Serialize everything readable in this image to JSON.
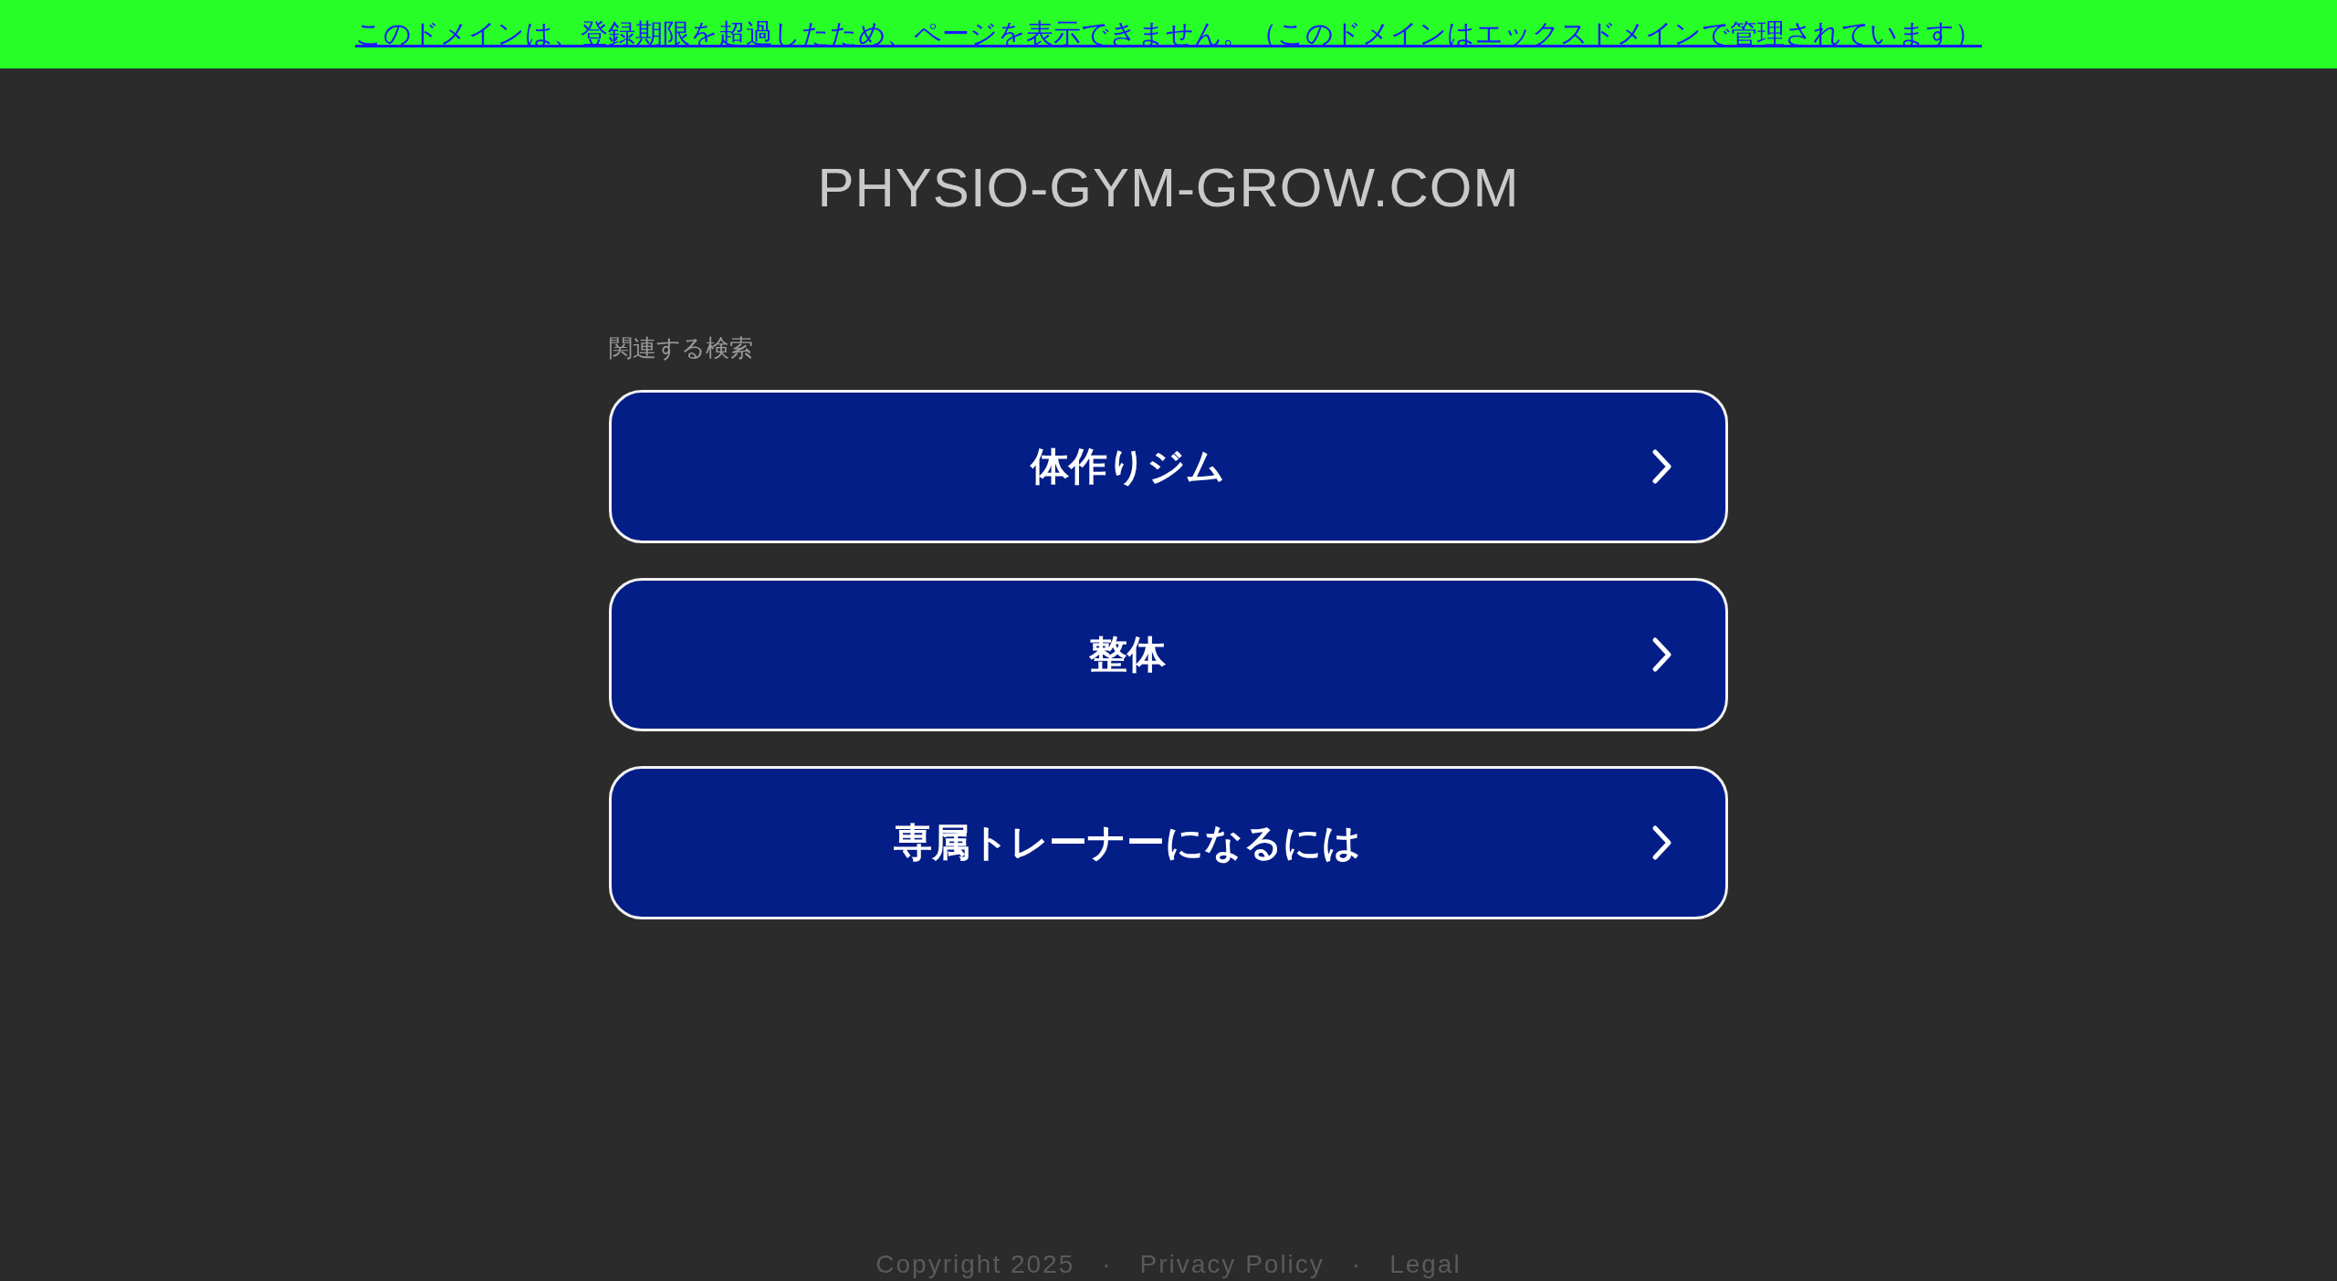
{
  "banner": {
    "text": "このドメインは、登録期限を超過したため、ページを表示できません。（このドメインはエックスドメインで管理されています）"
  },
  "domain_title": "PHYSIO-GYM-GROW.COM",
  "related": {
    "heading": "関連する検索",
    "links": [
      {
        "label": "体作りジム"
      },
      {
        "label": "整体"
      },
      {
        "label": "専属トレーナーになるには"
      }
    ]
  },
  "footer": {
    "copyright": "Copyright 2025",
    "links": [
      {
        "separator": "·",
        "label": "Privacy Policy"
      },
      {
        "separator": "·",
        "label": "Legal"
      }
    ]
  }
}
